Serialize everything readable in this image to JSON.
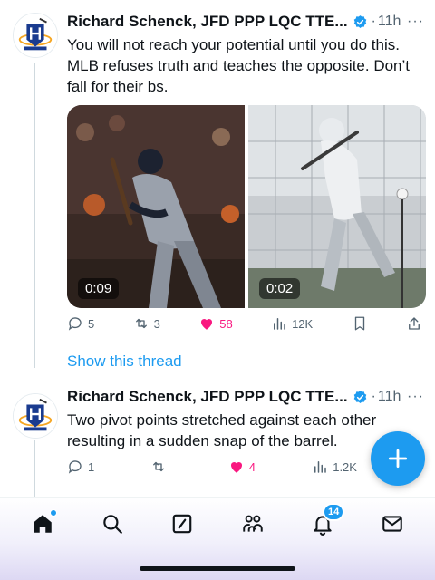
{
  "tweets": [
    {
      "author": "Richard Schenck, JFD PPP LQC TTE...",
      "separator": "·",
      "time": "11h",
      "more": "···",
      "text": "You will not reach your potential until you do this. MLB refuses truth and teaches the opposite. Don’t fall for their bs.",
      "media": [
        {
          "duration": "0:09"
        },
        {
          "duration": "0:02"
        }
      ],
      "actions": {
        "replies": "5",
        "reposts": "3",
        "likes": "58",
        "views": "12K"
      },
      "show_thread": "Show this thread"
    },
    {
      "author": "Richard Schenck, JFD PPP LQC TTE...",
      "separator": "·",
      "time": "11h",
      "more": "···",
      "text": "Two pivot points stretched against each other resulting in a sudden snap of the barrel.",
      "actions": {
        "replies": "1",
        "reposts": "",
        "likes": "4",
        "views": "1.2K"
      }
    }
  ],
  "bottom_nav": {
    "items": [
      "home-icon",
      "search-icon",
      "compose-icon",
      "communities-icon",
      "notifications-icon",
      "messages-icon"
    ],
    "notifications_badge": "14"
  },
  "colors": {
    "accent": "#1d9bf0",
    "like": "#f91880",
    "muted": "#536471"
  }
}
